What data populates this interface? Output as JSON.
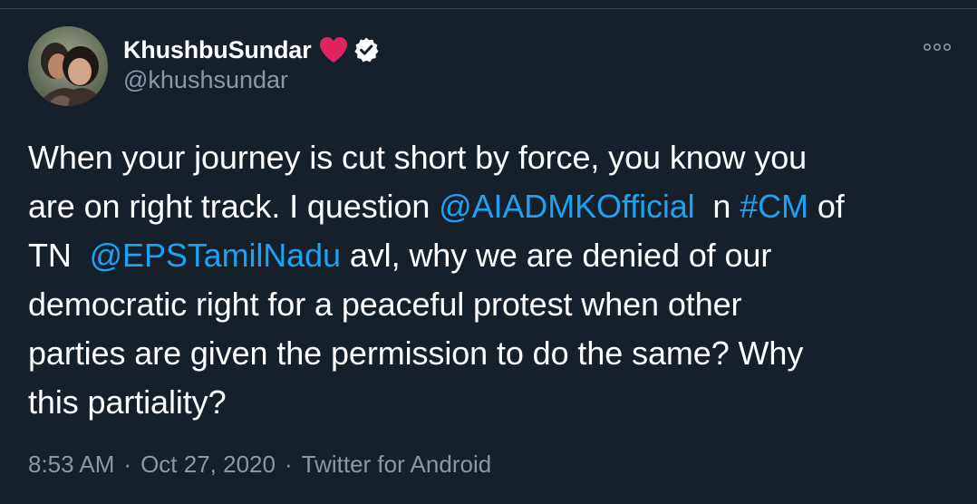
{
  "author": {
    "display_name": "KhushbuSundar",
    "handle": "@khushsundar",
    "avatar_icon": "profile-photo",
    "badges": [
      "heart-icon",
      "verified-icon"
    ],
    "colors": {
      "heart": "#e0245e",
      "verified_bg": "#ffffff",
      "verified_check": "#15202b"
    }
  },
  "tweet": {
    "lines": [
      [
        {
          "text": "When your journey is cut short by force, you know you",
          "type": "text"
        }
      ],
      [
        {
          "text": "are on right track. I question ",
          "type": "text"
        },
        {
          "text": "@AIADMKOfficial",
          "type": "mention"
        },
        {
          "text": "  n ",
          "type": "text"
        },
        {
          "text": "#CM",
          "type": "hashtag"
        },
        {
          "text": " of",
          "type": "text"
        }
      ],
      [
        {
          "text": "TN  ",
          "type": "text"
        },
        {
          "text": "@EPSTamilNadu",
          "type": "mention"
        },
        {
          "text": " avl, why we are denied of our",
          "type": "text"
        }
      ],
      [
        {
          "text": "democratic right for a peaceful protest when other",
          "type": "text"
        }
      ],
      [
        {
          "text": "parties are given the permission to do the same? Why",
          "type": "text"
        }
      ],
      [
        {
          "text": "this partiality?",
          "type": "text"
        }
      ]
    ]
  },
  "meta": {
    "time": "8:53 AM",
    "separator": "·",
    "date": "Oct 27, 2020",
    "source": "Twitter for Android"
  },
  "colors": {
    "background": "#15202b",
    "text": "#ffffff",
    "secondary_text": "#8899a6",
    "link": "#1da1f2"
  }
}
